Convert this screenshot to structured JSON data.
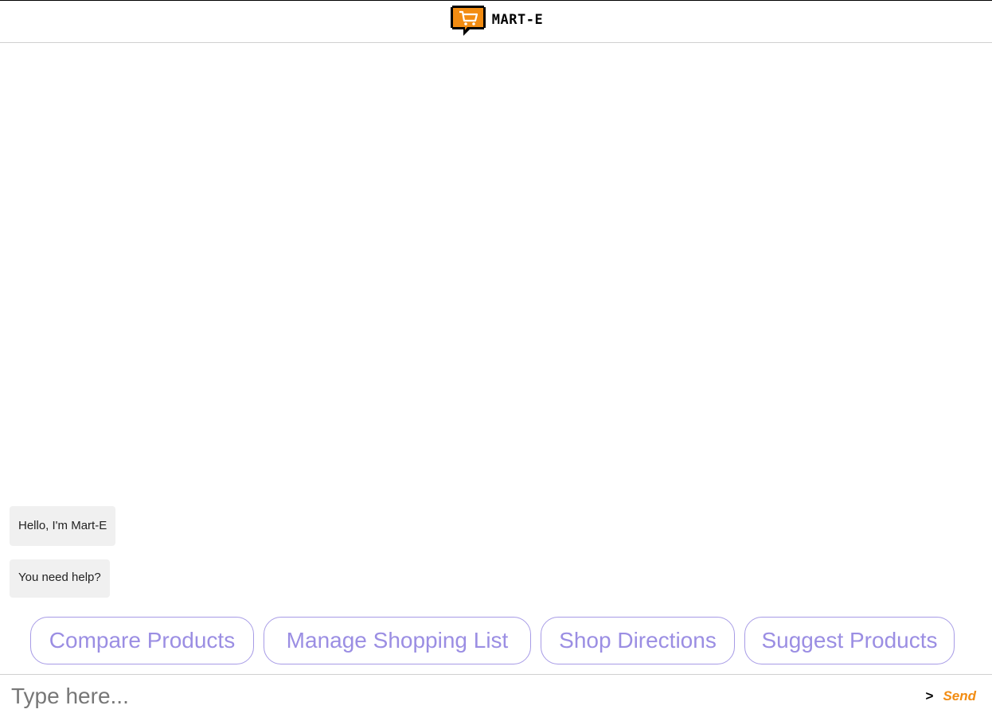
{
  "header": {
    "app_name": "MART-E",
    "logo_icon": "shopping-cart-speech-bubble-icon"
  },
  "colors": {
    "accent": "#f28c12",
    "chip": "#9b8ee3",
    "bubble_bg": "#f0f0f0"
  },
  "messages": [
    {
      "text": "Hello, I'm Mart-E"
    },
    {
      "text": "You need help?"
    }
  ],
  "quick_replies": [
    {
      "label": "Compare Products"
    },
    {
      "label": "Manage Shopping List"
    },
    {
      "label": "Shop Directions"
    },
    {
      "label": "Suggest Products"
    }
  ],
  "composer": {
    "placeholder": "Type here...",
    "value": "",
    "send_arrow": ">",
    "send_label": "Send"
  }
}
